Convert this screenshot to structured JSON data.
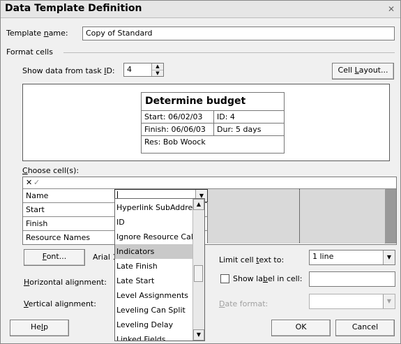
{
  "dialog": {
    "title": "Data Template Definition",
    "close_glyph": "✕"
  },
  "template_name": {
    "label_pre": "Template ",
    "label_u": "n",
    "label_post": "ame:",
    "value": "Copy of Standard"
  },
  "format_cells": {
    "label": "Format cells"
  },
  "show_data": {
    "label_pre": "Show data from task ",
    "label_u": "I",
    "label_post": "D:",
    "value": "4"
  },
  "cell_layout_button": {
    "pre": "Cell ",
    "u": "L",
    "post": "ayout..."
  },
  "preview": {
    "title": "Determine budget",
    "start": "Start:  06/02/03",
    "id": "ID:  4",
    "finish": "Finish: 06/06/03",
    "dur": "Dur: 5 days",
    "res": "Res:   Bob Woock"
  },
  "choose_cells": {
    "u": "C",
    "post": "hoose cell(s):",
    "x_glyph": "✕",
    "check_glyph": "✓"
  },
  "grid_rows": [
    "Name",
    "Start",
    "Finish",
    "Resource Names"
  ],
  "dropdown_list": {
    "items": [
      "Hyperlink SubAddress",
      "ID",
      "Ignore Resource Calendar",
      "Indicators",
      "Late Finish",
      "Late Start",
      "Level Assignments",
      "Leveling Can Split",
      "Leveling Delay",
      "Linked Fields"
    ],
    "selected": "Indicators",
    "up_glyph": "▲",
    "down_glyph": "▼"
  },
  "font_button": {
    "u": "F",
    "post": "ont..."
  },
  "font_value": "Arial 1",
  "horizontal_alignment": {
    "u": "H",
    "post": "orizontal alignment:"
  },
  "vertical_alignment": {
    "u": "V",
    "post": "ertical alignment:"
  },
  "limit_text": {
    "pre": "Limit cell ",
    "u": "t",
    "post": "ext to:",
    "value": "1 line"
  },
  "show_label": {
    "pre": "Show la",
    "u": "b",
    "post": "el in cell:"
  },
  "date_format": {
    "u": "D",
    "post": "ate format:"
  },
  "buttons": {
    "help_pre": "He",
    "help_u": "l",
    "help_post": "p",
    "ok": "OK",
    "cancel": "Cancel"
  }
}
